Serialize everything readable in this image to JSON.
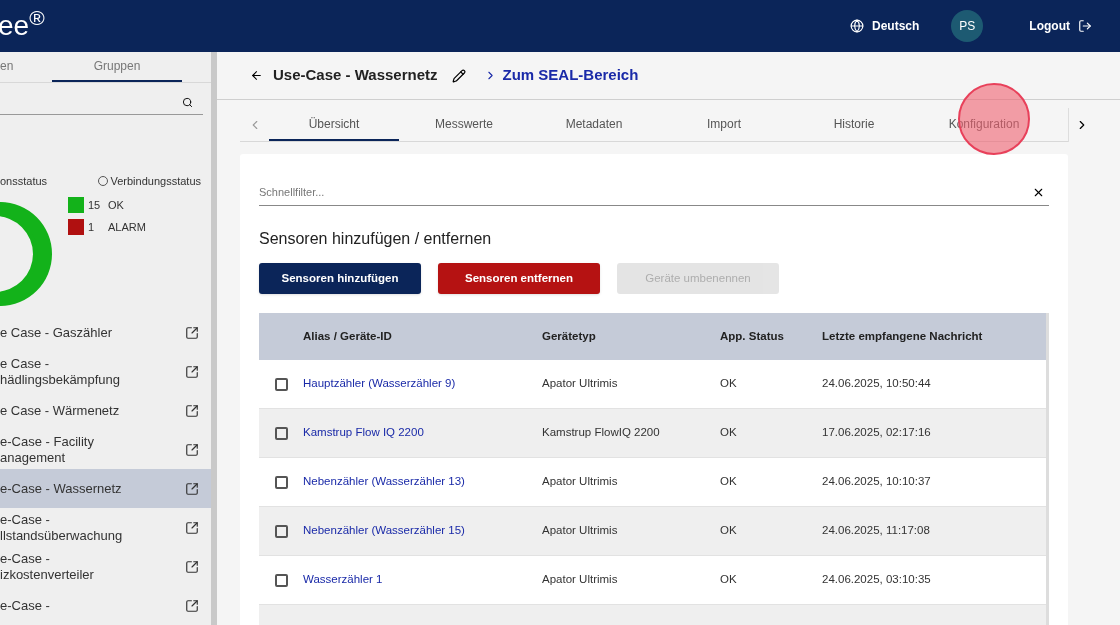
{
  "header": {
    "logo": "ee$^{®}$",
    "language": "Deutsch",
    "avatar": "PS",
    "logout": "Logout"
  },
  "sidebar": {
    "tabs": [
      {
        "label": "en",
        "selected": false
      },
      {
        "label": "Gruppen",
        "selected": true
      }
    ],
    "status_caption": "onsstatus",
    "status_option": {
      "label": "Verbindungsstatus",
      "selected": false
    },
    "legend": [
      {
        "count": "15",
        "label": "OK",
        "color": "#13b21a"
      },
      {
        "count": "1",
        "label": "ALARM",
        "color": "#b01010"
      }
    ],
    "groups": [
      {
        "label": "e Case - Gaszähler",
        "selected": false
      },
      {
        "label": "e Case -\nhädlingsbekämpfung",
        "selected": false
      },
      {
        "label": "e Case - Wärmenetz",
        "selected": false
      },
      {
        "label": "e-Case - Facility\nanagement",
        "selected": false
      },
      {
        "label": "e-Case - Wassernetz",
        "selected": true
      },
      {
        "label": "e-Case -\nllstandsüberwachung",
        "selected": false
      },
      {
        "label": "e-Case -\nizkostenverteiler",
        "selected": false
      },
      {
        "label": "e-Case -",
        "selected": false
      }
    ]
  },
  "page": {
    "title": "Use-Case - Wassernetz",
    "link": "Zum SEAL-Bereich",
    "tabs": [
      {
        "label": "Übersicht",
        "selected": true
      },
      {
        "label": "Messwerte",
        "selected": false
      },
      {
        "label": "Metadaten",
        "selected": false
      },
      {
        "label": "Import",
        "selected": false
      },
      {
        "label": "Historie",
        "selected": false
      },
      {
        "label": "Konfiguration",
        "selected": false
      }
    ],
    "filter": {
      "placeholder": "Schnellfilter..."
    },
    "section_title": "Sensoren hinzufügen / entfernen",
    "buttons": [
      {
        "label": "Sensoren hinzufügen",
        "kind": "primary",
        "disabled": false
      },
      {
        "label": "Sensoren entfernen",
        "kind": "danger",
        "disabled": false
      },
      {
        "label": "Geräte umbenennen",
        "kind": "neutral",
        "disabled": true
      }
    ],
    "table": {
      "columns": [
        "Alias / Geräte-ID",
        "Gerätetyp",
        "App. Status",
        "Letzte empfangene Nachricht"
      ],
      "rows": [
        {
          "checked": false,
          "alias": "Hauptzähler (Wasserzähler 9)",
          "type": "Apator Ultrimis",
          "status": "OK",
          "last": "24.06.2025, 10:50:44"
        },
        {
          "checked": false,
          "alias": "Kamstrup Flow IQ 2200",
          "type": "Kamstrup FlowIQ 2200",
          "status": "OK",
          "last": "17.06.2025, 02:17:16"
        },
        {
          "checked": false,
          "alias": "Nebenzähler (Wasserzähler 13)",
          "type": "Apator Ultrimis",
          "status": "OK",
          "last": "24.06.2025, 10:10:37"
        },
        {
          "checked": false,
          "alias": "Nebenzähler (Wasserzähler 15)",
          "type": "Apator Ultrimis",
          "status": "OK",
          "last": "24.06.2025, 11:17:08"
        },
        {
          "checked": false,
          "alias": "Wasserzähler 1",
          "type": "Apator Ultrimis",
          "status": "OK",
          "last": "24.06.2025, 03:10:35"
        }
      ]
    }
  }
}
